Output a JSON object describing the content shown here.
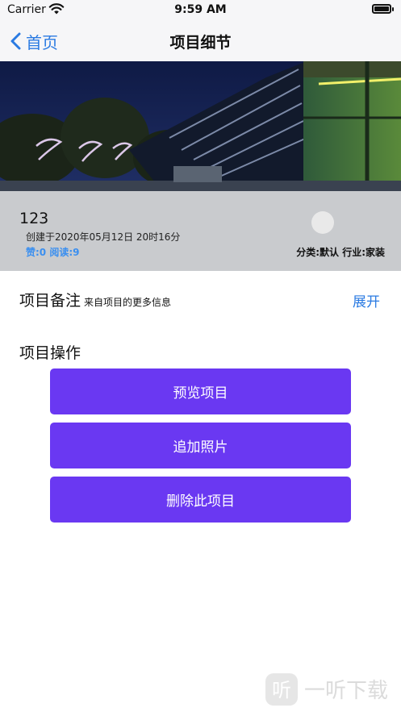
{
  "status_bar": {
    "carrier": "Carrier",
    "time": "9:59 AM"
  },
  "nav": {
    "back_label": "首页",
    "title": "项目细节"
  },
  "project": {
    "name": "123",
    "created": "创建于2020年05月12日  20时16分",
    "stats": "赞:0 阅读:9",
    "category": "分类:默认 行业:家装"
  },
  "notes": {
    "title": "项目备注",
    "subtitle": "来自项目的更多信息",
    "expand_label": "展开"
  },
  "operations": {
    "title": "项目操作",
    "buttons": [
      "预览项目",
      "追加照片",
      "删除此项目"
    ]
  },
  "watermark": {
    "text": "一听下载"
  },
  "colors": {
    "accent_blue": "#2a7ae2",
    "button_purple": "#6a38f2",
    "stats_blue": "#3a8ff0",
    "bar_background": "#f6f6f8"
  }
}
